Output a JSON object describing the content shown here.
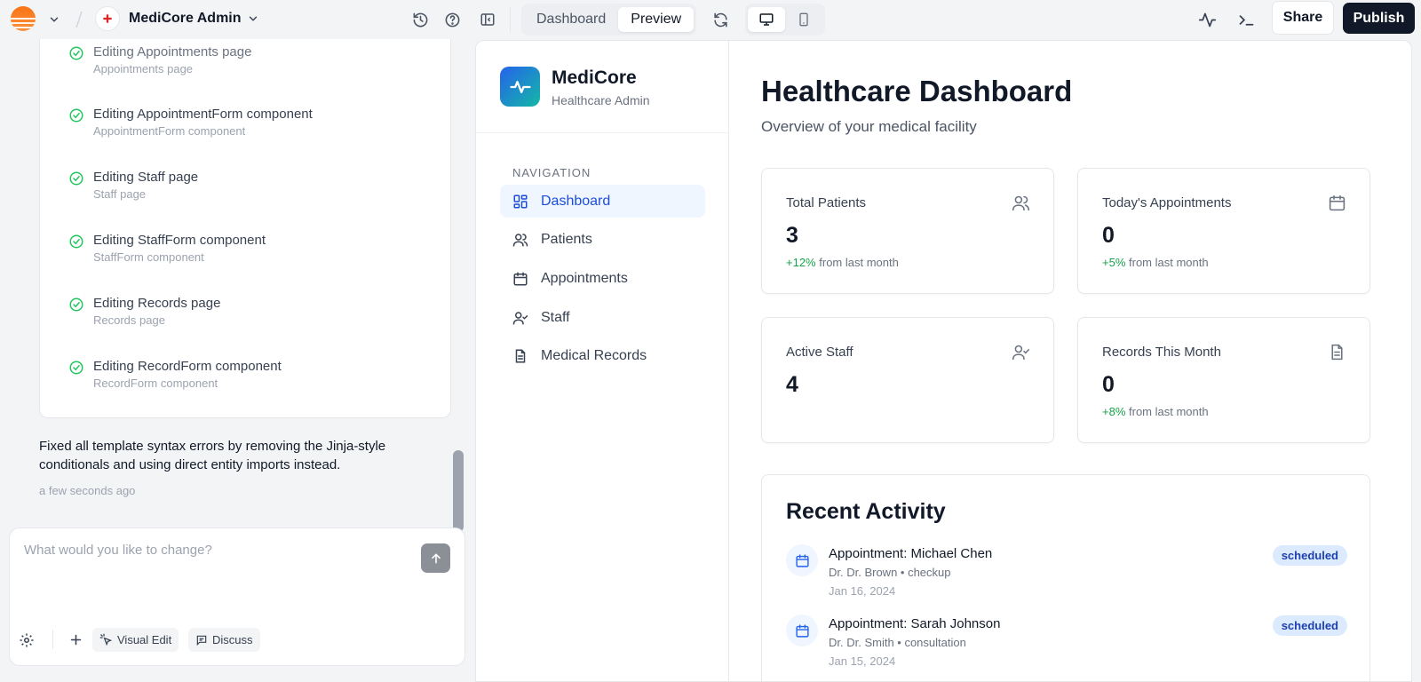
{
  "topbar": {
    "project_name": "MediCore Admin",
    "tabs": [
      "Dashboard",
      "Preview"
    ],
    "active_tab": "Preview",
    "share_label": "Share",
    "publish_label": "Publish"
  },
  "chat": {
    "steps": [
      {
        "title": "Editing Appointments page",
        "subtitle": "Appointments page"
      },
      {
        "title": "Editing AppointmentForm component",
        "subtitle": "AppointmentForm component"
      },
      {
        "title": "Editing Staff page",
        "subtitle": "Staff page"
      },
      {
        "title": "Editing StaffForm component",
        "subtitle": "StaffForm component"
      },
      {
        "title": "Editing Records page",
        "subtitle": "Records page"
      },
      {
        "title": "Editing RecordForm component",
        "subtitle": "RecordForm component"
      }
    ],
    "message": "Fixed all template syntax errors by removing the Jinja-style conditionals and using direct entity imports instead.",
    "message_time": "a few seconds ago",
    "composer_placeholder": "What would you like to change?",
    "visual_edit_label": "Visual Edit",
    "discuss_label": "Discuss"
  },
  "app": {
    "brand_name": "MediCore",
    "brand_subtitle": "Healthcare Admin",
    "nav_heading": "NAVIGATION",
    "nav_items": [
      {
        "label": "Dashboard",
        "icon": "dashboard-icon",
        "active": true
      },
      {
        "label": "Patients",
        "icon": "users-icon"
      },
      {
        "label": "Appointments",
        "icon": "calendar-icon"
      },
      {
        "label": "Staff",
        "icon": "user-check-icon"
      },
      {
        "label": "Medical Records",
        "icon": "file-text-icon"
      }
    ],
    "title": "Healthcare Dashboard",
    "subtitle": "Overview of your medical facility",
    "stats": [
      {
        "label": "Total Patients",
        "value": "3",
        "change": "+12%",
        "change_suffix": "from last month",
        "icon": "users-icon"
      },
      {
        "label": "Today's Appointments",
        "value": "0",
        "change": "+5%",
        "change_suffix": "from last month",
        "icon": "calendar-icon"
      },
      {
        "label": "Active Staff",
        "value": "4",
        "icon": "user-check-icon"
      },
      {
        "label": "Records This Month",
        "value": "0",
        "change": "+8%",
        "change_suffix": "from last month",
        "icon": "file-text-icon"
      }
    ],
    "recent_activity_title": "Recent Activity",
    "activities": [
      {
        "title": "Appointment: Michael Chen",
        "detail": "Dr. Dr. Brown • checkup",
        "date": "Jan 16, 2024",
        "status": "scheduled"
      },
      {
        "title": "Appointment: Sarah Johnson",
        "detail": "Dr. Dr. Smith • consultation",
        "date": "Jan 15, 2024",
        "status": "scheduled"
      }
    ]
  },
  "colors": {
    "accent": "#1d4ed8",
    "positive": "#16a34a",
    "badge_bg": "#dbeafe",
    "publish_bg": "#111827"
  }
}
